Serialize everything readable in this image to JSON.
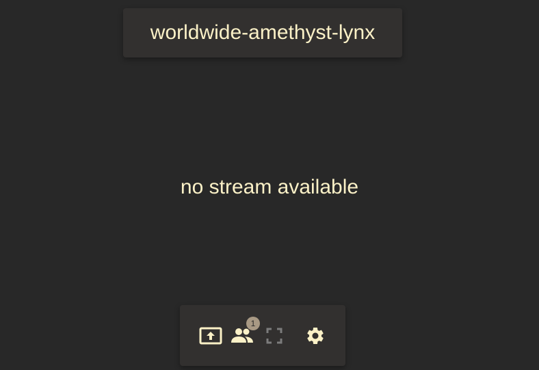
{
  "header": {
    "room_name": "worldwide-amethyst-lynx"
  },
  "main": {
    "status_text": "no stream available"
  },
  "toolbar": {
    "share_icon": "screen-share-icon",
    "users_icon": "people-icon",
    "users_count": "1",
    "fullscreen_icon": "fullscreen-icon",
    "settings_icon": "gear-icon"
  },
  "colors": {
    "background": "#282828",
    "panel": "#32302f",
    "text": "#fbf1c7",
    "badge": "#a89984",
    "disabled_icon": "#7c7c7c"
  }
}
